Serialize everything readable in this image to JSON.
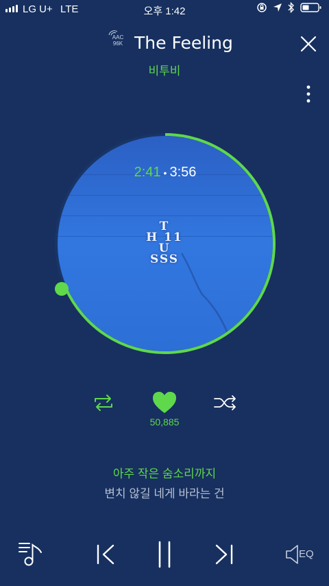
{
  "status_bar": {
    "carrier": "LG U+",
    "network": "LTE",
    "time": "오후 1:42"
  },
  "header": {
    "codec_line1": "AAC",
    "codec_line2": "96K",
    "title": "The Feeling",
    "artist": "비투비"
  },
  "player": {
    "elapsed": "2:41",
    "separator": "•",
    "total": "3:56",
    "progress": 0.682,
    "likes": "50,885",
    "liked": true
  },
  "album_art_text": {
    "line1": "T",
    "line2": "H 11 U",
    "line3": "SSS"
  },
  "lyrics": {
    "current": "아주 작은 숨소리까지",
    "next": "변치 않길 네게 바라는 건"
  },
  "bottom_bar": {
    "eq_label": "EQ"
  },
  "colors": {
    "background": "#17305f",
    "accent": "#5fd84c",
    "disc": "#2f6fd4"
  }
}
